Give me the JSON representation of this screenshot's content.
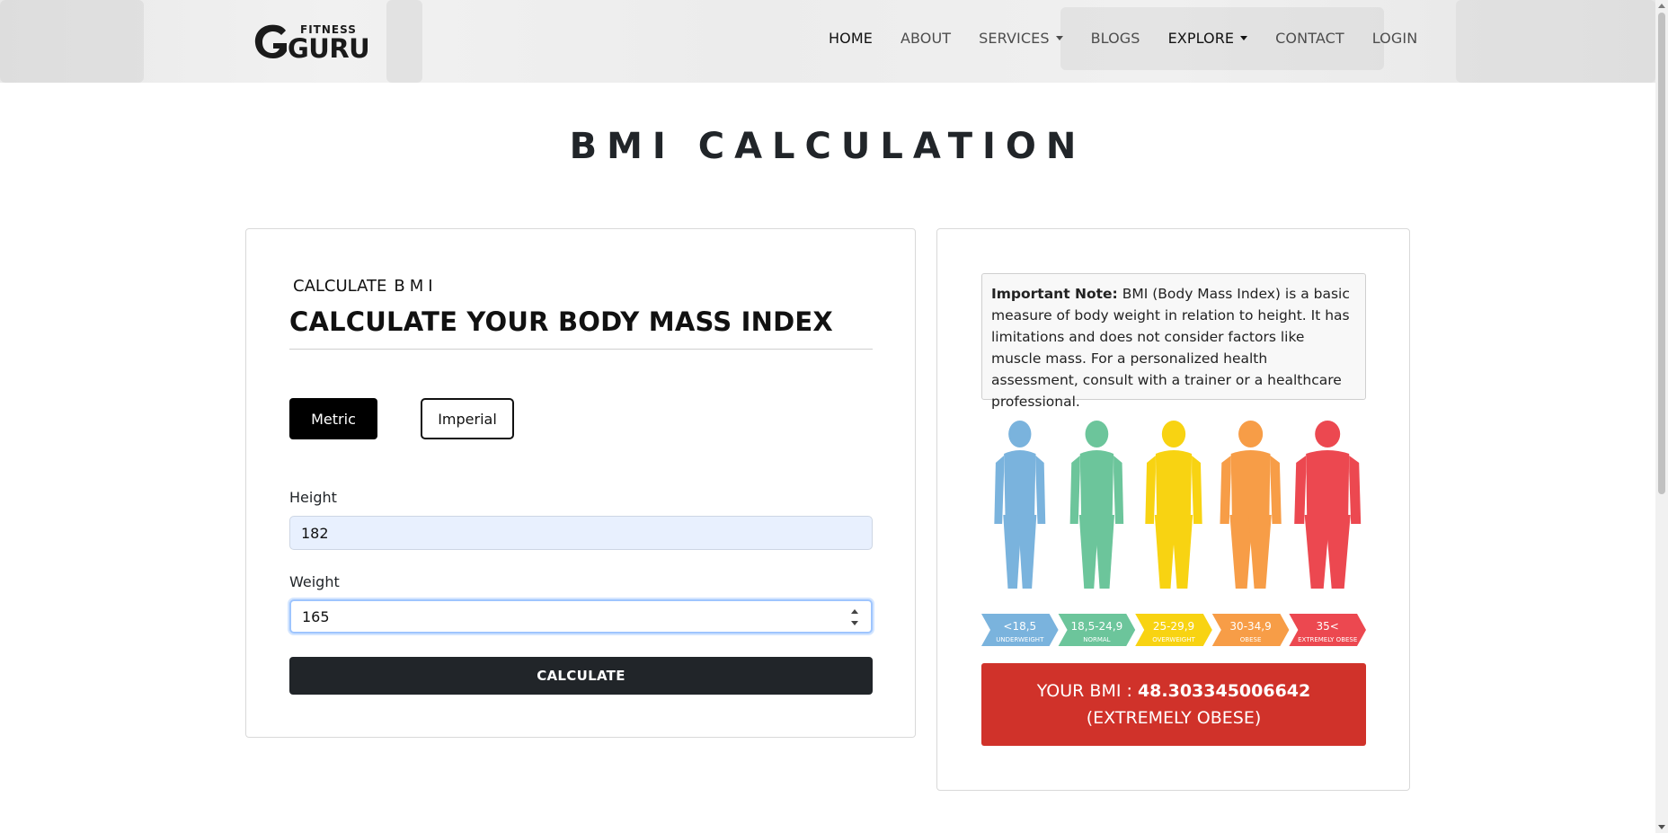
{
  "header": {
    "logo_text_top": "FITNESS",
    "logo_text_main": "GURU",
    "nav": [
      {
        "label": "HOME",
        "active": true,
        "dropdown": false
      },
      {
        "label": "ABOUT",
        "active": false,
        "dropdown": false
      },
      {
        "label": "SERVICES",
        "active": false,
        "dropdown": true
      },
      {
        "label": "BLOGS",
        "active": false,
        "dropdown": false
      },
      {
        "label": "EXPLORE",
        "active": false,
        "dropdown": true
      },
      {
        "label": "CONTACT",
        "active": false,
        "dropdown": false
      },
      {
        "label": "LOGIN",
        "active": false,
        "dropdown": false
      }
    ]
  },
  "page_title": "BMI CALCULATION",
  "calculator": {
    "subheading_prefix": "CALCULATE",
    "subheading_bmi": "BMI",
    "title": "CALCULATE YOUR BODY MASS INDEX",
    "unit_metric": "Metric",
    "unit_imperial": "Imperial",
    "selected_unit": "Metric",
    "height_label": "Height",
    "height_value": "182",
    "weight_label": "Weight",
    "weight_value": "165",
    "calculate_label": "CALCULATE"
  },
  "info": {
    "note_label": "Important Note:",
    "note_text": " BMI (Body Mass Index) is a basic measure of body weight in relation to height. It has limitations and does not consider factors like muscle mass. For a personalized health assessment, consult with a trainer or a healthcare professional.",
    "categories": [
      {
        "range": "<18,5",
        "name": "UNDERWEIGHT",
        "color": "#7ab3dd"
      },
      {
        "range": "18,5-24,9",
        "name": "NORMAL",
        "color": "#6cc59b"
      },
      {
        "range": "25-29,9",
        "name": "OVERWEIGHT",
        "color": "#f8d312"
      },
      {
        "range": "30-34,9",
        "name": "OBESE",
        "color": "#f79d47"
      },
      {
        "range": "35<",
        "name": "EXTREMELY OBESE",
        "color": "#ec4850"
      }
    ],
    "result_prefix": "YOUR BMI :",
    "result_value": "48.303345006642",
    "result_category": "(EXTREMELY OBESE)",
    "result_color": "#d0322a"
  }
}
